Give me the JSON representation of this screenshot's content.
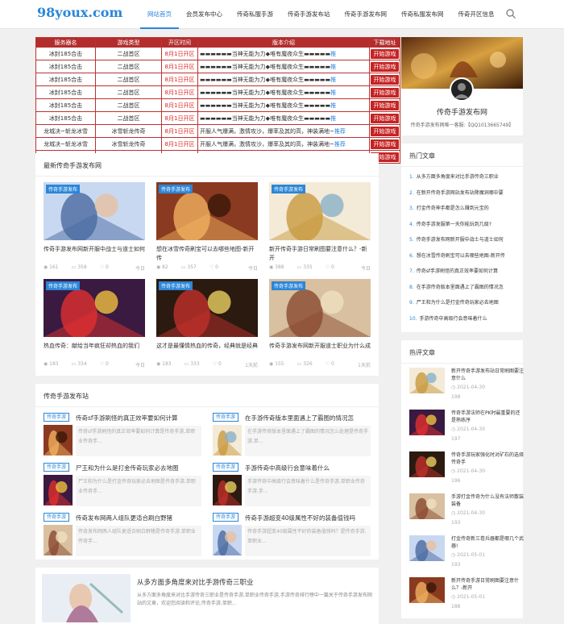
{
  "site": {
    "logo": "98youx.com"
  },
  "nav": [
    "网站首页",
    "会员发布中心",
    "传奇私服手游",
    "传奇手游发布站",
    "传奇手游发布网",
    "传奇私服发布网",
    "传奇开区信息"
  ],
  "server_table": {
    "headers": [
      "服务器名",
      "游戏类型",
      "开区时间",
      "版本介绍",
      "下载地址"
    ],
    "rows": [
      {
        "name": "冰封185合击",
        "type": "二战首区",
        "time": "8月1日开区",
        "intro_dark": "▬▬▬▬▬▬",
        "intro": "当神无能为力◆唯有魔夜众生▬▬▬▬▬",
        "link": "推",
        "btn": "开始游戏"
      },
      {
        "name": "冰封185合击",
        "type": "二战首区",
        "time": "8月1日开区",
        "intro_dark": "▬▬▬▬▬▬",
        "intro": "当神无能为力◆唯有魔夜众生▬▬▬▬▬",
        "link": "推",
        "btn": "开始游戏"
      },
      {
        "name": "冰封185合击",
        "type": "二战首区",
        "time": "8月1日开区",
        "intro_dark": "▬▬▬▬▬▬",
        "intro": "当神无能为力◆唯有魔夜众生▬▬▬▬▬",
        "link": "推",
        "btn": "开始游戏"
      },
      {
        "name": "冰封185合击",
        "type": "二战首区",
        "time": "8月1日开区",
        "intro_dark": "▬▬▬▬▬▬",
        "intro": "当神无能为力◆唯有魔夜众生▬▬▬▬▬",
        "link": "推",
        "btn": "开始游戏"
      },
      {
        "name": "冰封185合击",
        "type": "二战首区",
        "time": "8月1日开区",
        "intro_dark": "▬▬▬▬▬▬",
        "intro": "当神无能为力◆唯有魔夜众生▬▬▬▬▬",
        "link": "推",
        "btn": "开始游戏"
      },
      {
        "name": "冰封185合击",
        "type": "二战首区",
        "time": "8月1日开区",
        "intro_dark": "▬▬▬▬▬▬",
        "intro": "当神无能为力◆唯有魔夜众生▬▬▬▬▬",
        "link": "推",
        "btn": "开始游戏"
      },
      {
        "name": "龙城决~斩龙冰雪",
        "type": "冰雪斩龙传奇",
        "time": "8月1日开区",
        "intro_dark": "",
        "intro": "开服人气爆满，激情攻沙，爆率及其的高，神装满地~",
        "link": "推荐",
        "btn": "开始游戏"
      },
      {
        "name": "龙城决~斩龙冰雪",
        "type": "冰雪斩龙传奇",
        "time": "8月1日开区",
        "intro_dark": "",
        "intro": "开服人气爆满，激情攻沙，爆率及其的高，神装满地~",
        "link": "推荐",
        "btn": "开始游戏"
      },
      {
        "name": "龙城决~斩龙冰雪",
        "type": "冰雪斩龙传奇",
        "time": "8月1日开区",
        "intro_dark": "",
        "intro": "开服人气爆满，激情攻沙，爆率及其的高，神装满地~",
        "link": "推荐",
        "btn": "开始游戏"
      }
    ]
  },
  "latest": {
    "title": "最新传奇手游发布网",
    "cards": [
      {
        "tag": "传奇手游发布",
        "title": "传奇手游发布网新开服中战士与道士如何",
        "views": "161",
        "comments": "358",
        "likes": "0",
        "time": "今日"
      },
      {
        "tag": "传奇手游发布",
        "title": "想在冰雪传奇刷宝可以去哪些地图-新开传",
        "views": "82",
        "comments": "357",
        "likes": "0",
        "time": "今日"
      },
      {
        "tag": "传奇手游发布",
        "title": "新开传奇手游日常刷图要注意什么？-新开",
        "views": "388",
        "comments": "335",
        "likes": "0",
        "time": "今日"
      },
      {
        "tag": "传奇手游发布",
        "title": "热血传奇：献给当年疯狂却热血的我们",
        "views": "183",
        "comments": "334",
        "likes": "0",
        "time": "今日"
      },
      {
        "tag": "传奇手游发布",
        "title": "这才是最懂情热血的传奇，经典就是经典",
        "views": "183",
        "comments": "333",
        "likes": "0",
        "time": "1天前"
      },
      {
        "tag": "传奇手游发布",
        "title": "传奇手游发布网新开服道士职业为什么成",
        "views": "155",
        "comments": "326",
        "likes": "0",
        "time": "1天前"
      }
    ]
  },
  "station": {
    "title": "传奇手游发布站",
    "items": [
      {
        "tag": "传奇手游",
        "title": "传奇sf手游刷怪的真正效率要如何计算",
        "excerpt": "传奇sf手游刷怪的真正效率要如何计算是传奇手游,单职业传奇手..."
      },
      {
        "tag": "传奇手游",
        "title": "在手游传奇版本里面遇上了霸图的情况怎",
        "excerpt": "在手游传奇版本里面遇上了霸图的情况怎么处理是传奇手游,单..."
      },
      {
        "tag": "传奇手游",
        "title": "尸王和为什么是打金传奇玩家必去地图",
        "excerpt": "尸王和为什么是打金传奇玩家必去地图是传奇手游,单职业传奇手..."
      },
      {
        "tag": "传奇手游",
        "title": "手游传奇中高级行会意味着什么",
        "excerpt": "手游传奇中高级行会意味着什么是传奇手游,单职业传奇手游,手..."
      },
      {
        "tag": "传奇手游",
        "title": "传奇发布网两人组队更适合刷白野猪",
        "excerpt": "传奇发布网两人组队更适合刷白野猪是传奇手游,单职业传奇手..."
      },
      {
        "tag": "传奇手游",
        "title": "传奇手游超变40级属性不好的装备值钱吗",
        "excerpt": "传奇手游超变40级属性不好的装备值钱吗？是传奇手游,单职业..."
      }
    ]
  },
  "feature": {
    "title": "从多方面多角度来对比手游传奇三职业",
    "excerpt": "从多方面多角度来对比手游传奇三职业是传奇手游,单职业传奇手游,手游传奇排行榜中一篇关于传奇手游发布网站的文章，欢迎您阅读和评论,传奇手游,单职..."
  },
  "profile": {
    "name": "传奇手游发布网",
    "desc": "传奇手游发布网唯一客服:【QQ1013665749】"
  },
  "hot": {
    "title": "热门文章",
    "items": [
      "从多方面多角度来对比手游传奇三职业",
      "在新开传奇手游网站发布站降魔洞哪中要",
      "打金传奇神手都是怎么赚到元宝的",
      "传奇手游发服第一天你能玩到几级?",
      "传奇手游发布网新开服中战士与道士如何",
      "想在冰雪传奇刷宝可以去哪些地图-新开传",
      "传奇sf手游刷怪的真正效率要如何计算",
      "在手游传奇版本里面遇上了霸图的情况怎",
      "尸王和为什么是打金传奇玩家必去地图",
      "手游传奇中高级行会意味着什么"
    ]
  },
  "comment": {
    "title": "热评文章",
    "items": [
      {
        "title": "新开传奇手游发布站日常刷图要注意什么",
        "date": "2021-04-30",
        "views": "198"
      },
      {
        "title": "传奇手游法师在PK时最重要的还是熟练序",
        "date": "2021-04-30",
        "views": "197"
      },
      {
        "title": "传奇手游玩家强化时对矿石的选择传奇手",
        "date": "2021-04-30",
        "views": "196"
      },
      {
        "title": "手游打金传奇为什么没有法师散装装备",
        "date": "2021-04-30",
        "views": "193"
      },
      {
        "title": "打金传奇新三卷兵器都是哪几个武器!",
        "date": "2021-05-01",
        "views": "193"
      },
      {
        "title": "新开传奇手游日常刷图要注意什么？-新开",
        "date": "2021-05-01",
        "views": "188"
      }
    ]
  },
  "colors": {
    "accent": "#2a86d8",
    "table_red": "#b32d2d"
  }
}
